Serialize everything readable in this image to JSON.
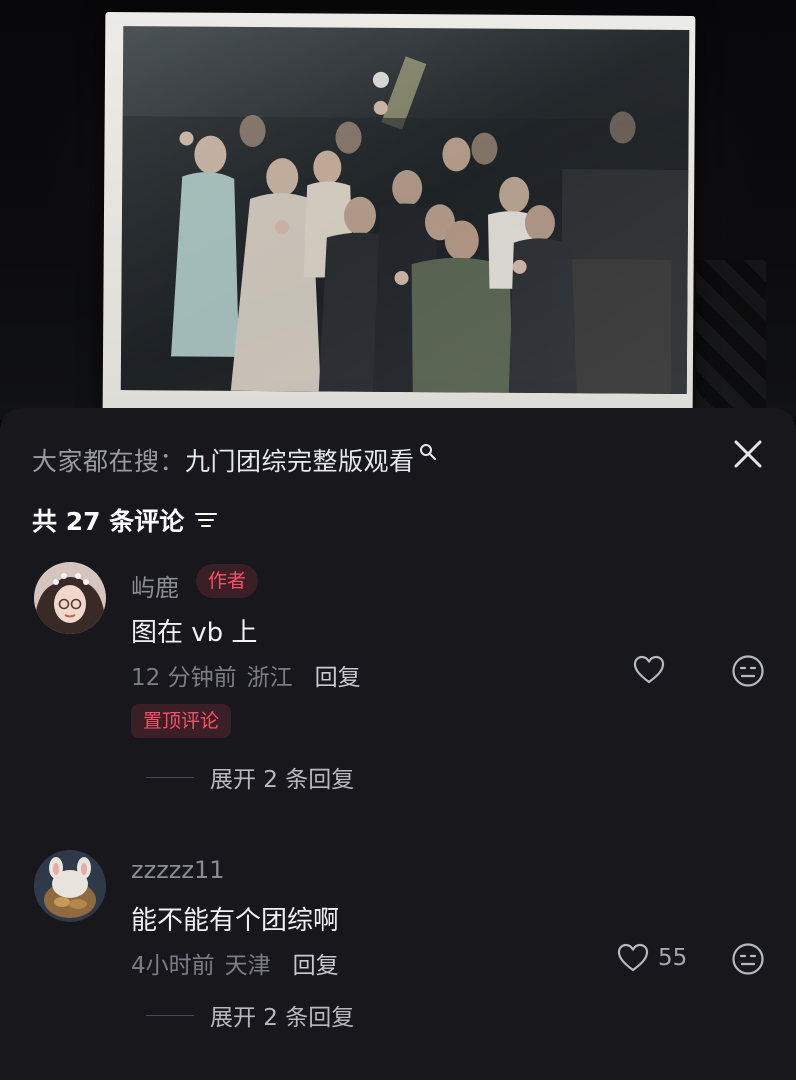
{
  "search": {
    "prefix": "大家都在搜：",
    "query": "九门团综完整版观看",
    "icon": "search-icon"
  },
  "close": {
    "icon": "close-icon"
  },
  "comments_header": {
    "count_label": "共 27 条评论",
    "sort_icon": "sort-icon"
  },
  "comments": [
    {
      "username": "屿鹿",
      "badge": "作者",
      "text": "图在 vb 上",
      "time": "12 分钟前",
      "location": "浙江",
      "reply_label": "回复",
      "like_count": "",
      "pinned_label": "置顶评论",
      "expand_label": "展开 2 条回复"
    },
    {
      "username": "zzzzz11",
      "badge": "",
      "text": "能不能有个团综啊",
      "time": "4小时前",
      "location": "天津",
      "reply_label": "回复",
      "like_count": "55",
      "pinned_label": "",
      "expand_label": "展开 2 条回复"
    }
  ],
  "colors": {
    "sheet_bg": "#17171c",
    "accent_red": "#ff4d6a",
    "muted_text": "#7c7c84"
  }
}
